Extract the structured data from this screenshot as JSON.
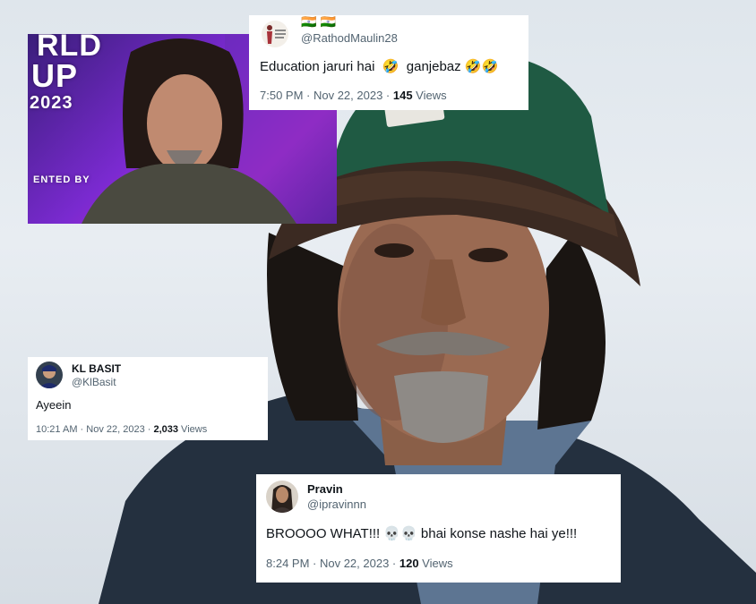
{
  "video_thumb": {
    "overlay_lines": [
      "RLD",
      "UP",
      "2023",
      "ENTED BY"
    ]
  },
  "tweets": [
    {
      "handle": "@RathodMaulin28",
      "flags": "🇮🇳 🇮🇳",
      "text": "Education jaruri hai  🤣  ganjebaz 🤣🤣",
      "time": "7:50 PM · Nov 22, 2023 · ",
      "views_count": "145",
      "views_label": " Views"
    },
    {
      "name": "KL BASIT",
      "handle": "@KlBasit",
      "text": "Ayeein",
      "time": "10:21 AM · Nov 22, 2023 · ",
      "views_count": "2,033",
      "views_label": " Views"
    },
    {
      "name": "Pravin",
      "handle": "@ipravinnn",
      "text": "BROOOO WHAT!!! 💀💀 bhai konse nashe hai ye!!!",
      "time": "8:24 PM · Nov 22, 2023 · ",
      "views_count": "120",
      "views_label": " Views"
    }
  ]
}
